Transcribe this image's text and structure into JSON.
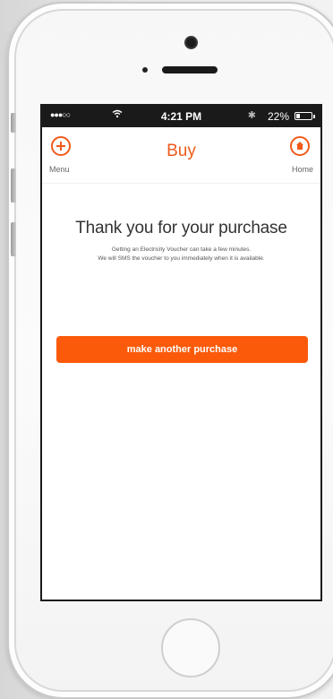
{
  "status_bar": {
    "signal": "●●●○○",
    "wifi_icon": "wifi-icon",
    "time": "4:21 PM",
    "bluetooth_icon": "bluetooth-icon",
    "battery_percent": "22%",
    "battery_level": 0.22
  },
  "nav": {
    "title": "Buy",
    "menu_label": "Menu",
    "home_label": "Home",
    "accent_color": "#f05a1a"
  },
  "content": {
    "heading": "Thank you for your purchase",
    "message_line1": "Getting an Electricity Voucher can take a few minutes.",
    "message_line2": "We will SMS the voucher to you immediately when it is available.",
    "button_label": "make another purchase",
    "button_color": "#fb5a0a"
  }
}
